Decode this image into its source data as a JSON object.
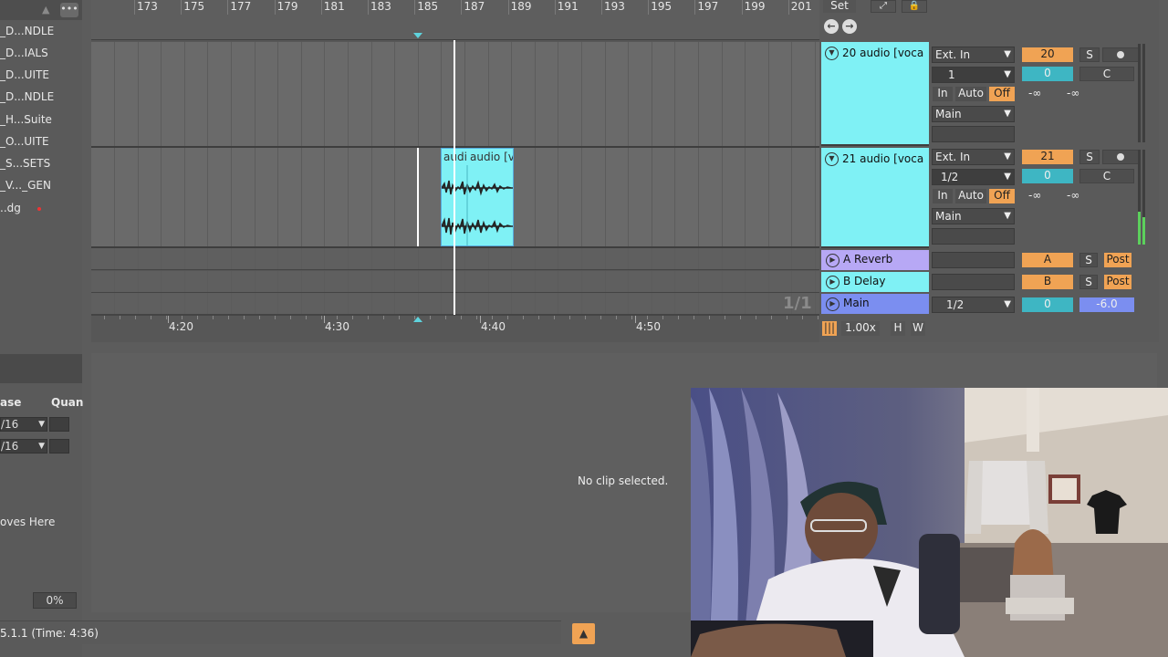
{
  "browser": {
    "items": [
      "_D...NDLE",
      "_D...IALS",
      "_D...UITE",
      "_D...NDLE",
      "_H...Suite",
      "_O...UITE",
      "_S...SETS",
      "_V..._GEN",
      "..dg"
    ],
    "more_icon": "ellipsis-icon",
    "collapse_icon": "triangle-up-icon",
    "col_release": "ase",
    "col_quantize": "Quan",
    "groove_rows": [
      "/16",
      "/16"
    ],
    "groove_hint": "oves Here",
    "percent": "0%"
  },
  "ruler": {
    "bars": [
      "173",
      "175",
      "177",
      "179",
      "181",
      "183",
      "185",
      "187",
      "189",
      "191",
      "193",
      "195",
      "197",
      "199",
      "201"
    ]
  },
  "time_ruler": {
    "labels": [
      "4:20",
      "4:30",
      "4:40",
      "4:50"
    ]
  },
  "arrangement": {
    "clip_labels": [
      "audi",
      "audio [v"
    ],
    "page_indicator": "1/1"
  },
  "mixer": {
    "set_label": "Set",
    "tracks": [
      {
        "name": "20 audio [voca",
        "input": "Ext. In",
        "channel": "1",
        "monitor_in": "In",
        "monitor_auto": "Auto",
        "monitor_off": "Off",
        "output": "Main",
        "number": "20",
        "solo": "S",
        "pan": "0",
        "pan_mode": "C",
        "send_a": "-∞",
        "send_b": "-∞"
      },
      {
        "name": "21 audio [voca",
        "input": "Ext. In",
        "channel": "1/2",
        "monitor_in": "In",
        "monitor_auto": "Auto",
        "monitor_off": "Off",
        "output": "Main",
        "number": "21",
        "solo": "S",
        "pan": "0",
        "pan_mode": "C",
        "send_a": "-∞",
        "send_b": "-∞"
      }
    ],
    "returns": [
      {
        "name": "A Reverb",
        "letter": "A",
        "solo": "S",
        "post": "Post"
      },
      {
        "name": "B Delay",
        "letter": "B",
        "solo": "S",
        "post": "Post"
      }
    ],
    "main": {
      "name": "Main",
      "output": "1/2",
      "pan": "0",
      "volume": "-6.0"
    },
    "zoom": "1.00x",
    "h_btn": "H",
    "w_btn": "W",
    "colors": {
      "cyan": "#7ff1f5",
      "orange": "#f0a354",
      "main_blue": "#7b8ef0",
      "return_purple": "#b7a8f5"
    }
  },
  "detail": {
    "message": "No clip selected."
  },
  "status": {
    "text": "5.1.1 (Time: 4:36)",
    "warn_icon": "warning-triangle-icon"
  }
}
